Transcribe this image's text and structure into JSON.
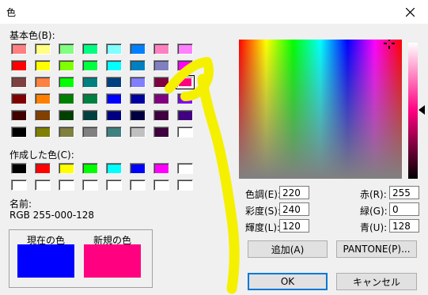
{
  "window": {
    "title": "色"
  },
  "basic_colors": {
    "label": "基本色(B):",
    "swatches": [
      "#ff8080",
      "#ffff80",
      "#80ff80",
      "#00ff80",
      "#80ffff",
      "#0080ff",
      "#ff80c0",
      "#ff80ff",
      "#ff0000",
      "#ffff00",
      "#80ff00",
      "#00ff40",
      "#00ffff",
      "#0080c0",
      "#8080c0",
      "#ff00ff",
      "#804040",
      "#ff8040",
      "#00ff00",
      "#008080",
      "#004080",
      "#8080ff",
      "#800040",
      "#ff0080",
      "#800000",
      "#ff8000",
      "#008000",
      "#008040",
      "#0000ff",
      "#0000a0",
      "#800080",
      "#8000ff",
      "#400000",
      "#804000",
      "#004000",
      "#004040",
      "#000080",
      "#000040",
      "#400040",
      "#400080",
      "#000000",
      "#808000",
      "#808040",
      "#808080",
      "#408080",
      "#c0c0c0",
      "#400040",
      "#ffffff"
    ],
    "selected_index": 23
  },
  "custom_colors": {
    "label": "作成した色(C):",
    "swatches": [
      "#000000",
      "#ff0000",
      "#ffff00",
      "#00ff00",
      "#00ffff",
      "#0000ff",
      "#ff00ff",
      "#ffffff",
      "#ffffff",
      "#ffffff",
      "#ffffff",
      "#ffffff",
      "#ffffff",
      "#ffffff",
      "#ffffff",
      "#ffffff"
    ]
  },
  "color_name": {
    "label": "名前:",
    "value": "RGB 255-000-128"
  },
  "preview": {
    "current_label": "現在の色",
    "current_color": "#0000ff",
    "new_label": "新規の色",
    "new_color": "#ff0080"
  },
  "hsl": {
    "hue_label": "色調(E):",
    "hue_value": "220",
    "sat_label": "彩度(S):",
    "sat_value": "240",
    "lum_label": "輝度(L):",
    "lum_value": "120"
  },
  "rgb": {
    "red_label": "赤(R):",
    "red_value": "255",
    "green_label": "緑(G):",
    "green_value": "0",
    "blue_label": "青(U):",
    "blue_value": "128"
  },
  "buttons": {
    "add": "追加(A)",
    "pantone": "PANTONE(P)...",
    "ok": "OK",
    "cancel": "キャンセル"
  },
  "annotation_color": "#f5f000"
}
